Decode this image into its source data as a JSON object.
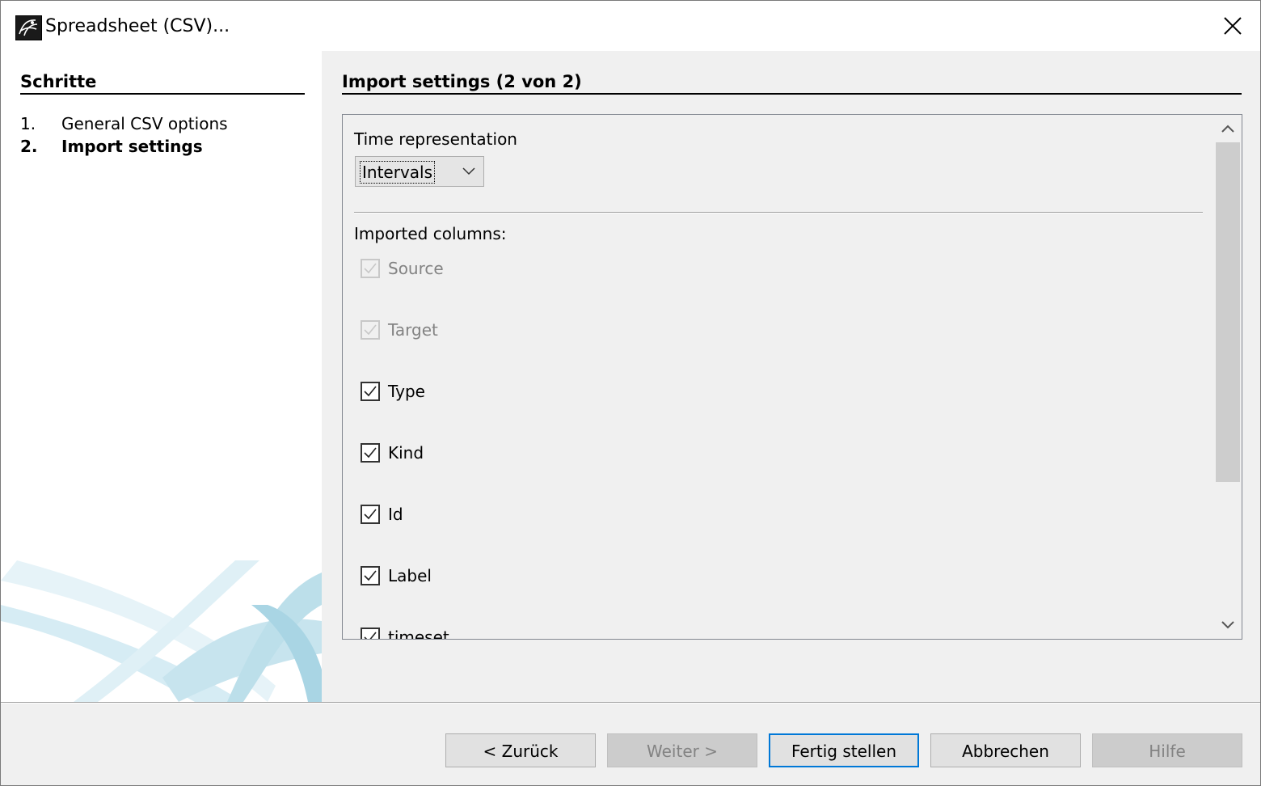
{
  "window": {
    "title": "Spreadsheet (CSV)...",
    "app_icon": "gephi-logo-icon",
    "close_icon": "close-icon"
  },
  "sidebar": {
    "title": "Schritte",
    "steps": [
      {
        "number": "1.",
        "label": "General CSV options",
        "active": false
      },
      {
        "number": "2.",
        "label": "Import settings",
        "active": true
      }
    ]
  },
  "main": {
    "title": "Import settings (2 von 2)",
    "time_representation": {
      "label": "Time representation",
      "selected": "Intervals"
    },
    "imported_columns_label": "Imported columns:",
    "columns": [
      {
        "label": "Source",
        "checked": true,
        "enabled": false
      },
      {
        "label": "Target",
        "checked": true,
        "enabled": false
      },
      {
        "label": "Type",
        "checked": true,
        "enabled": true
      },
      {
        "label": "Kind",
        "checked": true,
        "enabled": true
      },
      {
        "label": "Id",
        "checked": true,
        "enabled": true
      },
      {
        "label": "Label",
        "checked": true,
        "enabled": true
      },
      {
        "label": "timeset",
        "checked": true,
        "enabled": true
      }
    ]
  },
  "buttons": {
    "back": "< Zurück",
    "next": "Weiter >",
    "finish": "Fertig stellen",
    "cancel": "Abbrechen",
    "help": "Hilfe"
  },
  "colors": {
    "default_button_border": "#0078d7",
    "disabled_text": "#838383"
  }
}
